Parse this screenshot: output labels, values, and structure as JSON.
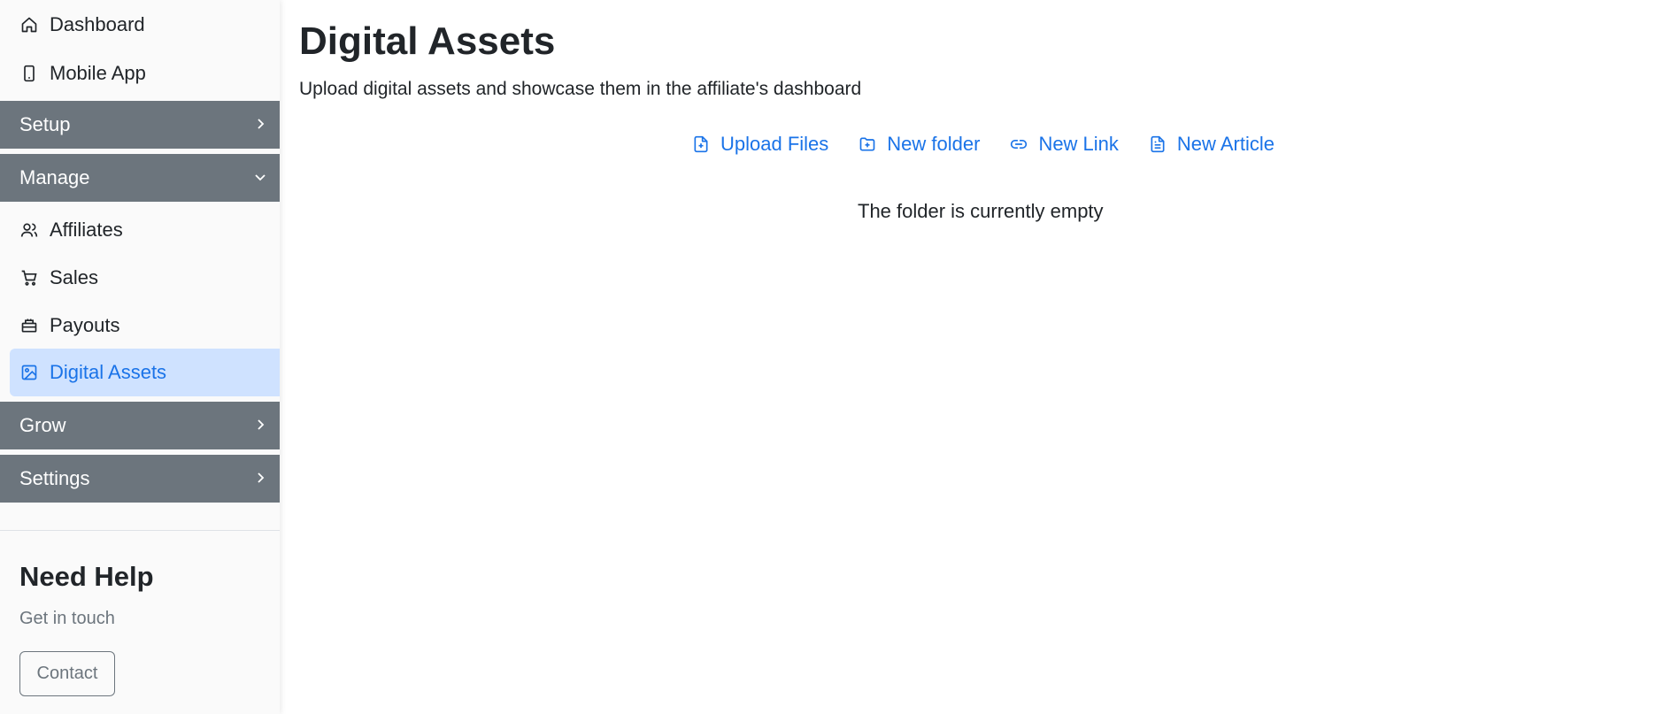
{
  "sidebar": {
    "top_items": [
      {
        "label": "Dashboard",
        "icon": "home-icon"
      },
      {
        "label": "Mobile App",
        "icon": "phone-icon"
      }
    ],
    "sections": {
      "setup": "Setup",
      "manage": "Manage",
      "grow": "Grow",
      "settings": "Settings"
    },
    "manage_items": [
      {
        "label": "Affiliates",
        "icon": "users-icon"
      },
      {
        "label": "Sales",
        "icon": "cart-icon"
      },
      {
        "label": "Payouts",
        "icon": "payouts-icon"
      },
      {
        "label": "Digital Assets",
        "icon": "image-icon",
        "active": true
      }
    ],
    "help": {
      "title": "Need Help",
      "subtitle": "Get in touch",
      "contact_label": "Contact"
    }
  },
  "main": {
    "title": "Digital Assets",
    "description": "Upload digital assets and showcase them in the affiliate's dashboard",
    "actions": [
      {
        "label": "Upload Files",
        "icon": "file-plus-icon"
      },
      {
        "label": "New folder",
        "icon": "folder-plus-icon"
      },
      {
        "label": "New Link",
        "icon": "link-icon"
      },
      {
        "label": "New Article",
        "icon": "file-text-icon"
      }
    ],
    "empty_message": "The folder is currently empty"
  },
  "colors": {
    "accent": "#1a73e8",
    "active_bg": "#cfe2ff",
    "section_bg": "#6c757d"
  }
}
